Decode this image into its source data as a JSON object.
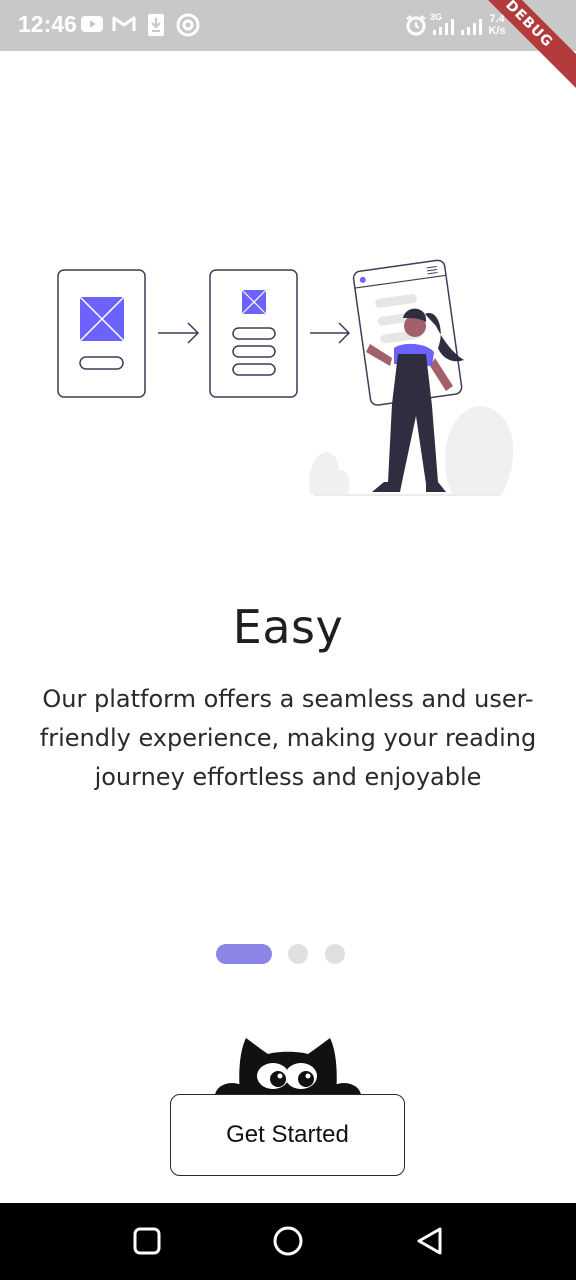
{
  "status_bar": {
    "time": "12:46",
    "network_type": "3G",
    "speed_value": "7.4",
    "speed_unit": "K/s",
    "left_icons": [
      "youtube-icon",
      "gmail-icon",
      "download-icon",
      "at-sign-icon"
    ],
    "right_icons": [
      "alarm-icon",
      "signal-icon",
      "signal-icon",
      "wifi-icon"
    ]
  },
  "debug_banner": "DEBUG",
  "onboarding": {
    "title": "Easy",
    "description": "Our platform offers a seamless and user-friendly experience, making your reading journey effortless and enjoyable",
    "page_count": 3,
    "active_page": 0,
    "accent_color": "#8b86e6"
  },
  "cta": {
    "label": "Get Started"
  },
  "nav_bar": {
    "buttons": [
      "recent-apps-icon",
      "home-icon",
      "back-icon"
    ]
  }
}
